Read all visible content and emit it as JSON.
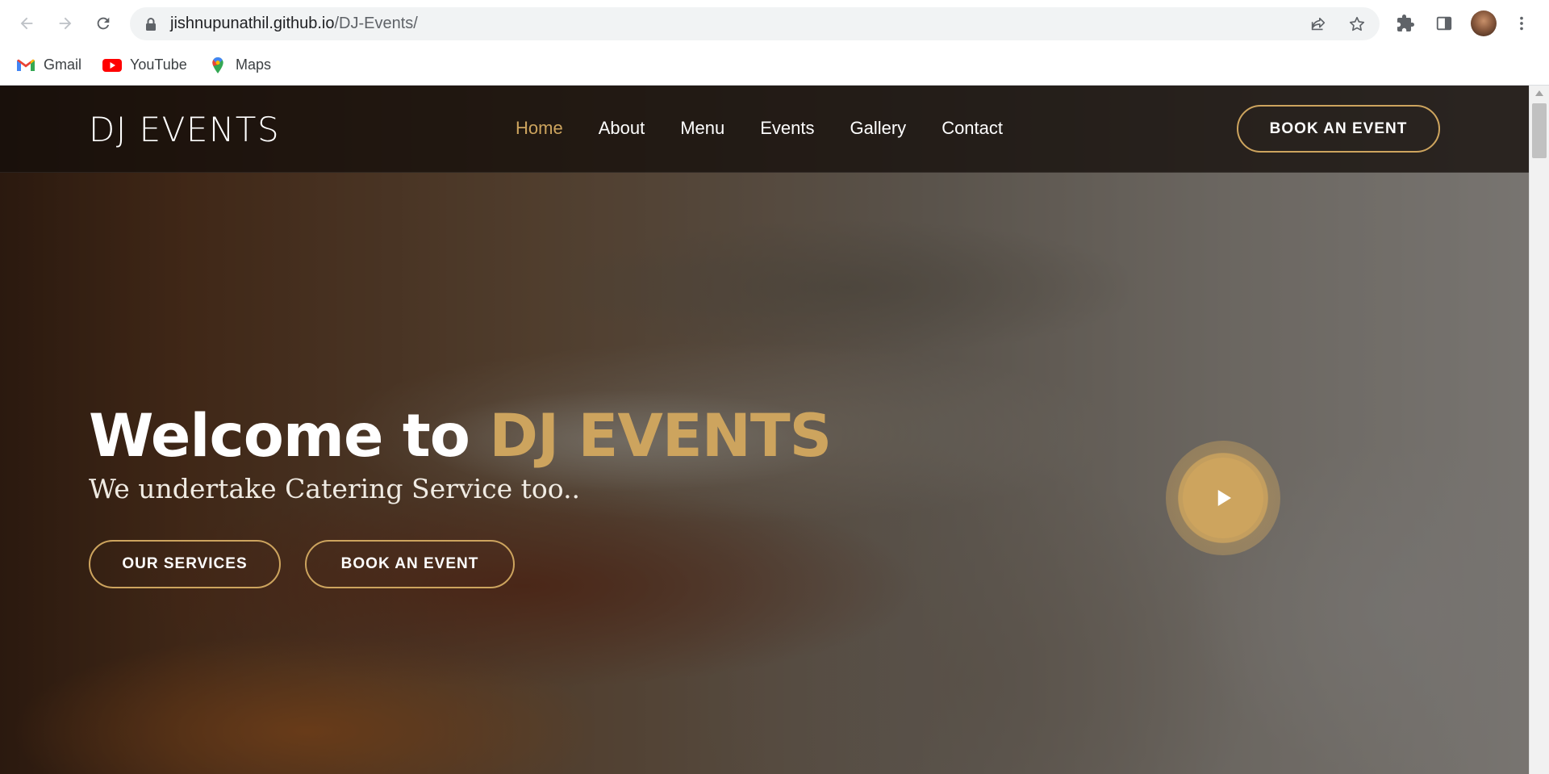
{
  "browser": {
    "url_host": "jishnupunathil.github.io",
    "url_path": "/DJ-Events/",
    "bookmarks": [
      {
        "label": "Gmail",
        "icon": "gmail-icon"
      },
      {
        "label": "YouTube",
        "icon": "youtube-icon"
      },
      {
        "label": "Maps",
        "icon": "maps-icon"
      }
    ]
  },
  "site": {
    "logo": "DJ EVENTS",
    "nav": [
      {
        "label": "Home",
        "active": true
      },
      {
        "label": "About",
        "active": false
      },
      {
        "label": "Menu",
        "active": false
      },
      {
        "label": "Events",
        "active": false
      },
      {
        "label": "Gallery",
        "active": false
      },
      {
        "label": "Contact",
        "active": false
      }
    ],
    "header_cta": "BOOK AN EVENT"
  },
  "hero": {
    "title_prefix": "Welcome to ",
    "title_brand": "DJ EVENTS",
    "subtitle": "We undertake Catering Service too..",
    "btn_services": "OUR SERVICES",
    "btn_book": "BOOK AN EVENT"
  },
  "colors": {
    "accent": "#cda45e",
    "header_bg": "#140e0a"
  }
}
